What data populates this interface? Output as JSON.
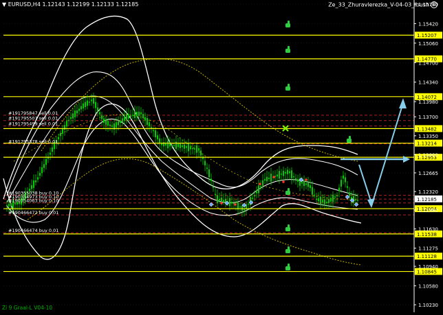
{
  "window": {
    "symbol_header": "EURUSD,H4  1.12143 1.12199 1.12133 1.12185",
    "indicator_name": "Ze_33_Zhuravlerezka_V-04-03_Ibush",
    "footer_text": "Zi 9 Graal-L V04-10"
  },
  "colors": {
    "background": "#000000",
    "level_line": "#ffff00",
    "level_label_bg": "#ffff00",
    "trade_line": "#b22222",
    "envelope": "#ffffff",
    "candles": "#00cc00",
    "trend_arrow": "#87ceeb",
    "grid": "#2a2a2a",
    "thumbs_up_icon": "#2ecc40"
  },
  "chart_data": {
    "type": "line",
    "y_axis": {
      "min": 1.1013,
      "max": 1.1578,
      "tick_labels": [
        "1.15780",
        "1.15420",
        "1.15060",
        "1.14700",
        "1.14340",
        "1.13980",
        "1.13700",
        "1.13350",
        "1.13000",
        "1.12665",
        "1.12320",
        "1.11980",
        "1.11630",
        "1.11275",
        "1.10940",
        "1.10580",
        "1.10230"
      ]
    },
    "highlighted_levels": [
      {
        "value": 1.15207,
        "label": "1.15207"
      },
      {
        "value": 1.1477,
        "label": "1.14770"
      },
      {
        "value": 1.14072,
        "label": "1.14072"
      },
      {
        "value": 1.13482,
        "label": "1.13482"
      },
      {
        "value": 1.13214,
        "label": "1.13214"
      },
      {
        "value": 1.12953,
        "label": "1.12953"
      },
      {
        "value": 1.12004,
        "label": "1.12004"
      },
      {
        "value": 1.11538,
        "label": "1.11538"
      },
      {
        "value": 1.11128,
        "label": "1.11128"
      },
      {
        "value": 1.10845,
        "label": "1.10845"
      }
    ],
    "current_price": {
      "value": 1.12185,
      "label": "1.12185"
    },
    "trade_lines": [
      {
        "value": 1.1373,
        "label": "#191795847 sell 0.01"
      },
      {
        "value": 1.1363,
        "label": "#191795507 sell 0.01"
      },
      {
        "value": 1.1353,
        "label": "#191795499 sell 0.01"
      },
      {
        "value": 1.132,
        "label": "#191795378 sell 0.01"
      },
      {
        "value": 1.1225,
        "label": "#190355038 buy 0.10"
      },
      {
        "value": 1.1218,
        "label": "#190354973 buy 0.10"
      },
      {
        "value": 1.1211,
        "label": "#190354063 buy 0.10"
      },
      {
        "value": 1.1189,
        "label": "#190466472 buy 0.01"
      },
      {
        "value": 1.1156,
        "label": "#190466474 buy 0.01"
      }
    ],
    "grid": true
  }
}
